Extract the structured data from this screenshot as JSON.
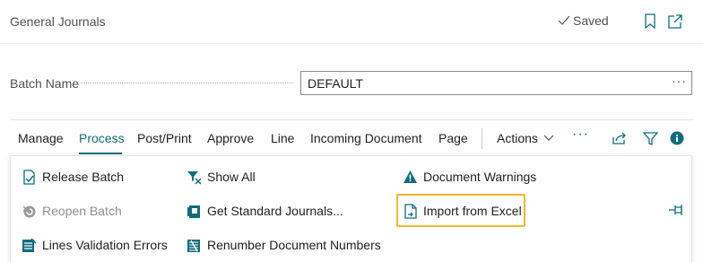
{
  "header": {
    "title": "General Journals",
    "saved_label": "Saved"
  },
  "batch": {
    "label": "Batch Name",
    "value": "DEFAULT",
    "ellipsis": "···"
  },
  "tabs": [
    {
      "label": "Manage"
    },
    {
      "label": "Process",
      "active": true
    },
    {
      "label": "Post/Print"
    },
    {
      "label": "Approve"
    },
    {
      "label": "Line"
    },
    {
      "label": "Incoming Document"
    },
    {
      "label": "Page"
    },
    {
      "label": "Actions"
    }
  ],
  "more_label": "···",
  "actions": {
    "release_batch": "Release Batch",
    "reopen_batch": "Reopen Batch",
    "lines_validation_errors": "Lines Validation Errors",
    "show_all": "Show All",
    "get_standard_journals": "Get Standard Journals...",
    "renumber_document_numbers": "Renumber Document Numbers",
    "document_warnings": "Document Warnings",
    "import_from_excel": "Import from Excel"
  },
  "colors": {
    "accent": "#0f6e7d",
    "highlight": "#f1b72e",
    "disabled": "#8f8f8f"
  },
  "icons": [
    "checkmark-icon",
    "bookmark-icon",
    "open-new-window-icon",
    "share-icon",
    "filter-icon",
    "info-icon",
    "release-document-icon",
    "reopen-icon",
    "lines-validation-icon",
    "show-all-icon",
    "get-standard-journals-icon",
    "renumber-icon",
    "warning-icon",
    "import-excel-icon",
    "pin-icon"
  ]
}
